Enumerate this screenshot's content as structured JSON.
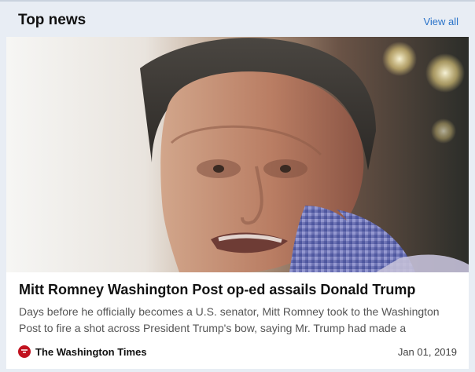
{
  "header": {
    "title": "Top news",
    "view_all_label": "View all"
  },
  "article": {
    "headline": "Mitt Romney Washington Post op-ed assails Donald Trump",
    "summary": "Days before he officially becomes a U.S. senator, Mitt Romney took to the Washington Post to fire a shot across President Trump's bow, saying Mr. Trump had made a",
    "source_name": "The Washington Times",
    "date": "Jan 01, 2019"
  },
  "icons": {
    "source_logo": "washington-times-logo-icon"
  },
  "colors": {
    "accent_link": "#2a73c9",
    "background": "#e8edf4",
    "logo_red": "#c1121f"
  }
}
